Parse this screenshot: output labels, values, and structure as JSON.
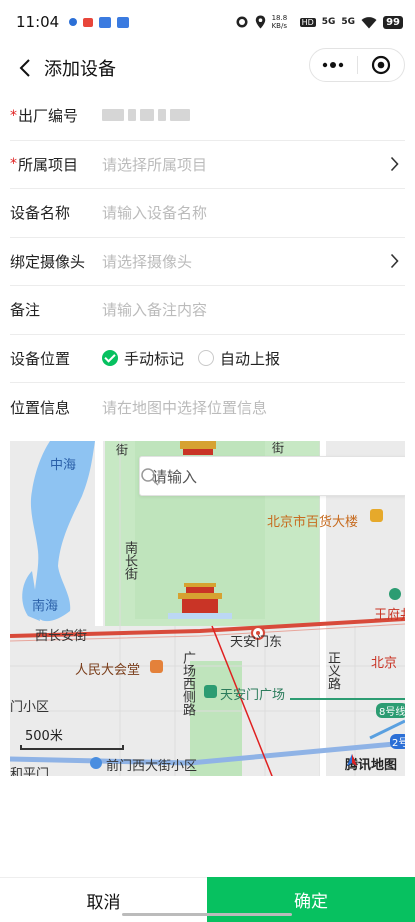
{
  "status_bar": {
    "time": "11:04",
    "network_speed": "18.8 KB/s",
    "hd_label": "HD",
    "signal_1": "5G",
    "signal_2": "5G",
    "battery": "99"
  },
  "nav": {
    "title": "添加设备",
    "more_icon": "more-dots-icon",
    "close_icon": "target-circle-icon"
  },
  "form": {
    "serial": {
      "label": "出厂编号"
    },
    "project": {
      "label": "所属项目",
      "placeholder": "请选择所属项目"
    },
    "device_name": {
      "label": "设备名称",
      "placeholder": "请输入设备名称"
    },
    "camera": {
      "label": "绑定摄像头",
      "placeholder": "请选择摄像头"
    },
    "remark": {
      "label": "备注",
      "placeholder": "请输入备注内容"
    },
    "location_mode": {
      "label": "设备位置",
      "options": [
        "手动标记",
        "自动上报"
      ],
      "selected": "手动标记"
    },
    "location_info": {
      "label": "位置信息",
      "placeholder": "请在地图中选择位置信息"
    }
  },
  "map": {
    "search_placeholder": "请输入",
    "labels": {
      "zhonghai": "中海",
      "nanhai": "南海",
      "jie_top": "街",
      "jie_top2": "街",
      "nanchang": "南长街",
      "bainian": "北京市百货大楼",
      "wangfu": "王府井",
      "xichangan": "西长安街",
      "tiananmen_east": "天安门东",
      "great_hall": "人民大会堂",
      "square_west": "广场西侧路",
      "tiananmen_square": "天安门广场",
      "zhengyi": "正义路",
      "beijing": "北京",
      "line8": "8号线",
      "line2": "2号",
      "menxiaoqu": "门小区",
      "qianmen_west": "前门西大街小区",
      "pingmen": "和平门"
    },
    "scale": "500米",
    "logo": "腾讯地图"
  },
  "footer": {
    "cancel": "取消",
    "confirm": "确定"
  },
  "colors": {
    "primary": "#07c160",
    "required": "#e02020",
    "placeholder": "#bbbbbb",
    "road_red": "#d84a3a"
  }
}
